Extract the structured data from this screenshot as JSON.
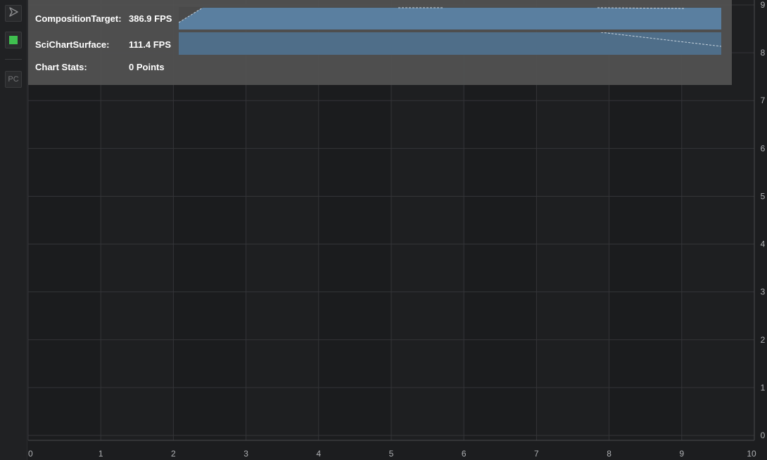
{
  "toolbar": {
    "play_icon": "play-icon",
    "stop_icon": "stop-icon",
    "pc_label": "PC",
    "stop_color": "#3fbf4f"
  },
  "stats": {
    "composition_label": "CompositionTarget:",
    "composition_value": "386.9 FPS",
    "surface_label": "SciChartSurface:",
    "surface_value": "111.4 FPS",
    "chart_stats_label": "Chart Stats:",
    "chart_stats_value": "0 Points"
  },
  "colors": {
    "background": "#1c1d1f",
    "overlay": "#525252",
    "sparkline_fill": "#5a7fa0",
    "grid": "#343538"
  },
  "chart_data": {
    "type": "line",
    "series": [],
    "xlim": [
      0,
      10
    ],
    "ylim": [
      0,
      9
    ],
    "x_ticks": [
      "0",
      "1",
      "2",
      "3",
      "4",
      "5",
      "6",
      "7",
      "8",
      "9",
      "10"
    ],
    "y_ticks": [
      "0",
      "1",
      "2",
      "3",
      "4",
      "5",
      "6",
      "7",
      "8",
      "9"
    ],
    "grid": true
  }
}
